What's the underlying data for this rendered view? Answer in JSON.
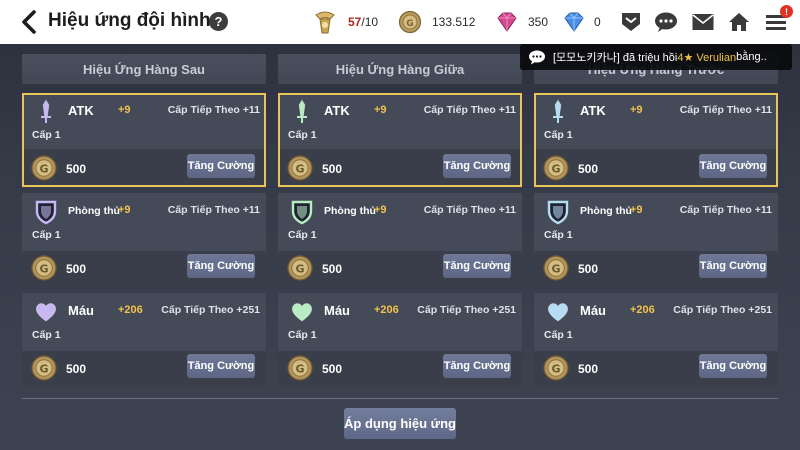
{
  "header": {
    "title": "Hiệu ứng đội hình",
    "help_label": "?",
    "stamina": {
      "current": "57",
      "max": "/10"
    },
    "gold": "133.512",
    "gem_pink": "350",
    "gem_blue": "0",
    "mail_badge": "!"
  },
  "notification": {
    "prefix": "[모모노키카나] đã triệu hồi ",
    "highlight": "4★ Verulian",
    "suffix": " bằng.."
  },
  "columns": [
    {
      "title": "Hiệu Ứng Hàng Sau",
      "cards": [
        {
          "stat": "ATK",
          "value": "+9",
          "next": "Cấp Tiếp Theo +11",
          "level": "Cấp 1",
          "cost": "500",
          "button": "Tăng Cường",
          "icon": "sword-icon",
          "active": true
        },
        {
          "stat": "Phòng thủ",
          "value": "+9",
          "next": "Cấp Tiếp Theo +11",
          "level": "Cấp 1",
          "cost": "500",
          "button": "Tăng Cường",
          "icon": "shield-icon",
          "active": false
        },
        {
          "stat": "Máu",
          "value": "+206",
          "next": "Cấp Tiếp Theo +251",
          "level": "Cấp 1",
          "cost": "500",
          "button": "Tăng Cường",
          "icon": "heart-icon",
          "active": false
        }
      ]
    },
    {
      "title": "Hiệu Ứng Hàng Giữa",
      "cards": [
        {
          "stat": "ATK",
          "value": "+9",
          "next": "Cấp Tiếp Theo +11",
          "level": "Cấp 1",
          "cost": "500",
          "button": "Tăng Cường",
          "icon": "sword-icon",
          "active": true
        },
        {
          "stat": "Phòng thủ",
          "value": "+9",
          "next": "Cấp Tiếp Theo +11",
          "level": "Cấp 1",
          "cost": "500",
          "button": "Tăng Cường",
          "icon": "shield-icon",
          "active": false
        },
        {
          "stat": "Máu",
          "value": "+206",
          "next": "Cấp Tiếp Theo +251",
          "level": "Cấp 1",
          "cost": "500",
          "button": "Tăng Cường",
          "icon": "heart-icon",
          "active": false
        }
      ]
    },
    {
      "title": "Hiệu Ứng Hàng Trước",
      "cards": [
        {
          "stat": "ATK",
          "value": "+9",
          "next": "Cấp Tiếp Theo +11",
          "level": "Cấp 1",
          "cost": "500",
          "button": "Tăng Cường",
          "icon": "sword-icon",
          "active": true
        },
        {
          "stat": "Phòng thủ",
          "value": "+9",
          "next": "Cấp Tiếp Theo +11",
          "level": "Cấp 1",
          "cost": "500",
          "button": "Tăng Cường",
          "icon": "shield-icon",
          "active": false
        },
        {
          "stat": "Máu",
          "value": "+206",
          "next": "Cấp Tiếp Theo +251",
          "level": "Cấp 1",
          "cost": "500",
          "button": "Tăng Cường",
          "icon": "heart-icon",
          "active": false
        }
      ]
    }
  ],
  "icon_colors": {
    "column_0": "#c7b8f2",
    "column_1": "#b8ecc2",
    "column_2": "#b6dcf2",
    "gold_border": "#e6c65a",
    "bonus_text": "#f0c24a"
  },
  "apply_button": "Áp dụng hiệu ứng"
}
